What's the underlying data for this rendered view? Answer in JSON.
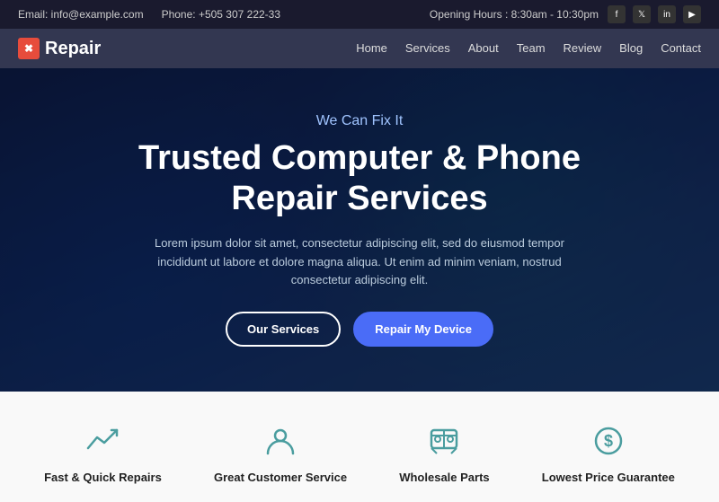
{
  "topbar": {
    "email_label": "Email: info@example.com",
    "phone_label": "Phone: +505 307 222-33",
    "opening_label": "Opening Hours : 8:30am - 10:30pm",
    "social": [
      "f",
      "t",
      "in",
      "yt"
    ]
  },
  "navbar": {
    "logo_text": "Repair",
    "links": [
      "Home",
      "Services",
      "About",
      "Team",
      "Review",
      "Blog",
      "Contact"
    ]
  },
  "hero": {
    "subtitle": "We Can Fix It",
    "title": "Trusted Computer & Phone Repair Services",
    "description": "Lorem ipsum dolor sit amet, consectetur adipiscing elit, sed do eiusmod tempor incididunt ut labore et dolore magna aliqua. Ut enim ad minim veniam, nostrud consectetur adipiscing elit.",
    "btn_services": "Our Services",
    "btn_repair": "Repair My Device"
  },
  "features": [
    {
      "id": "fast-repairs",
      "label": "Fast & Quick Repairs",
      "icon": "📈"
    },
    {
      "id": "customer-service",
      "label": "Great Customer Service",
      "icon": "👤"
    },
    {
      "id": "wholesale-parts",
      "label": "Wholesale Parts",
      "icon": "🎮"
    },
    {
      "id": "lowest-price",
      "label": "Lowest Price Guarantee",
      "icon": "💲"
    }
  ]
}
